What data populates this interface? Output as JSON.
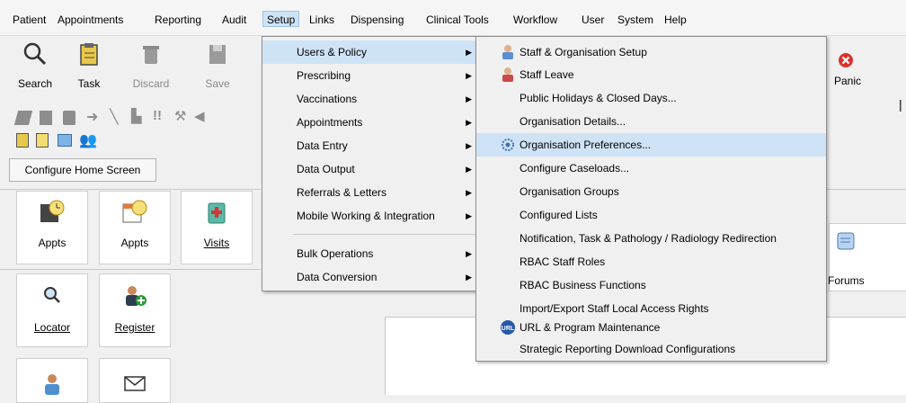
{
  "menubar": {
    "items": [
      "Patient",
      "Appointments",
      "Reporting",
      "Audit",
      "Setup",
      "Links",
      "Dispensing",
      "Clinical Tools",
      "Workflow",
      "User",
      "System",
      "Help"
    ],
    "active": "Setup"
  },
  "toolbar": {
    "search": "Search",
    "task": "Task",
    "discard": "Discard",
    "save": "Save",
    "configure_home": "Configure Home Screen",
    "panic": "Panic"
  },
  "tiles": {
    "appts1": "Appts",
    "appts2": "Appts",
    "visits": "Visits",
    "locator": "Locator",
    "register": "Register",
    "forums": "Forums"
  },
  "setup_menu": {
    "items": [
      {
        "label": "Users & Policy",
        "submenu": true
      },
      {
        "label": "Prescribing",
        "submenu": true
      },
      {
        "label": "Vaccinations",
        "submenu": true
      },
      {
        "label": "Appointments",
        "submenu": true
      },
      {
        "label": "Data Entry",
        "submenu": true
      },
      {
        "label": "Data Output",
        "submenu": true
      },
      {
        "label": "Referrals & Letters",
        "submenu": true
      },
      {
        "label": "Mobile Working & Integration",
        "submenu": true
      },
      {
        "label": "Bulk Operations",
        "submenu": true
      },
      {
        "label": "Data Conversion",
        "submenu": true
      }
    ]
  },
  "users_policy_menu": {
    "items": [
      {
        "label": "Staff & Organisation Setup",
        "icon": "staff-icon"
      },
      {
        "label": "Staff Leave",
        "icon": "staff-leave-icon"
      },
      {
        "label": "Public Holidays & Closed Days..."
      },
      {
        "label": "Organisation Details..."
      },
      {
        "label": "Organisation Preferences...",
        "icon": "preferences-icon",
        "selected": true
      },
      {
        "label": "Configure Caseloads..."
      },
      {
        "label": "Organisation Groups"
      },
      {
        "label": "Configured Lists"
      },
      {
        "label": "Notification, Task & Pathology / Radiology Redirection"
      },
      {
        "label": "RBAC Staff Roles"
      },
      {
        "label": "RBAC Business Functions"
      },
      {
        "label": "Import/Export Staff Local Access Rights"
      },
      {
        "label": "URL & Program Maintenance",
        "icon": "url-icon"
      },
      {
        "label": "Strategic Reporting Download Configurations"
      }
    ]
  },
  "colors": {
    "highlight": "#cfe3f7",
    "panic_red": "#d9322a"
  }
}
